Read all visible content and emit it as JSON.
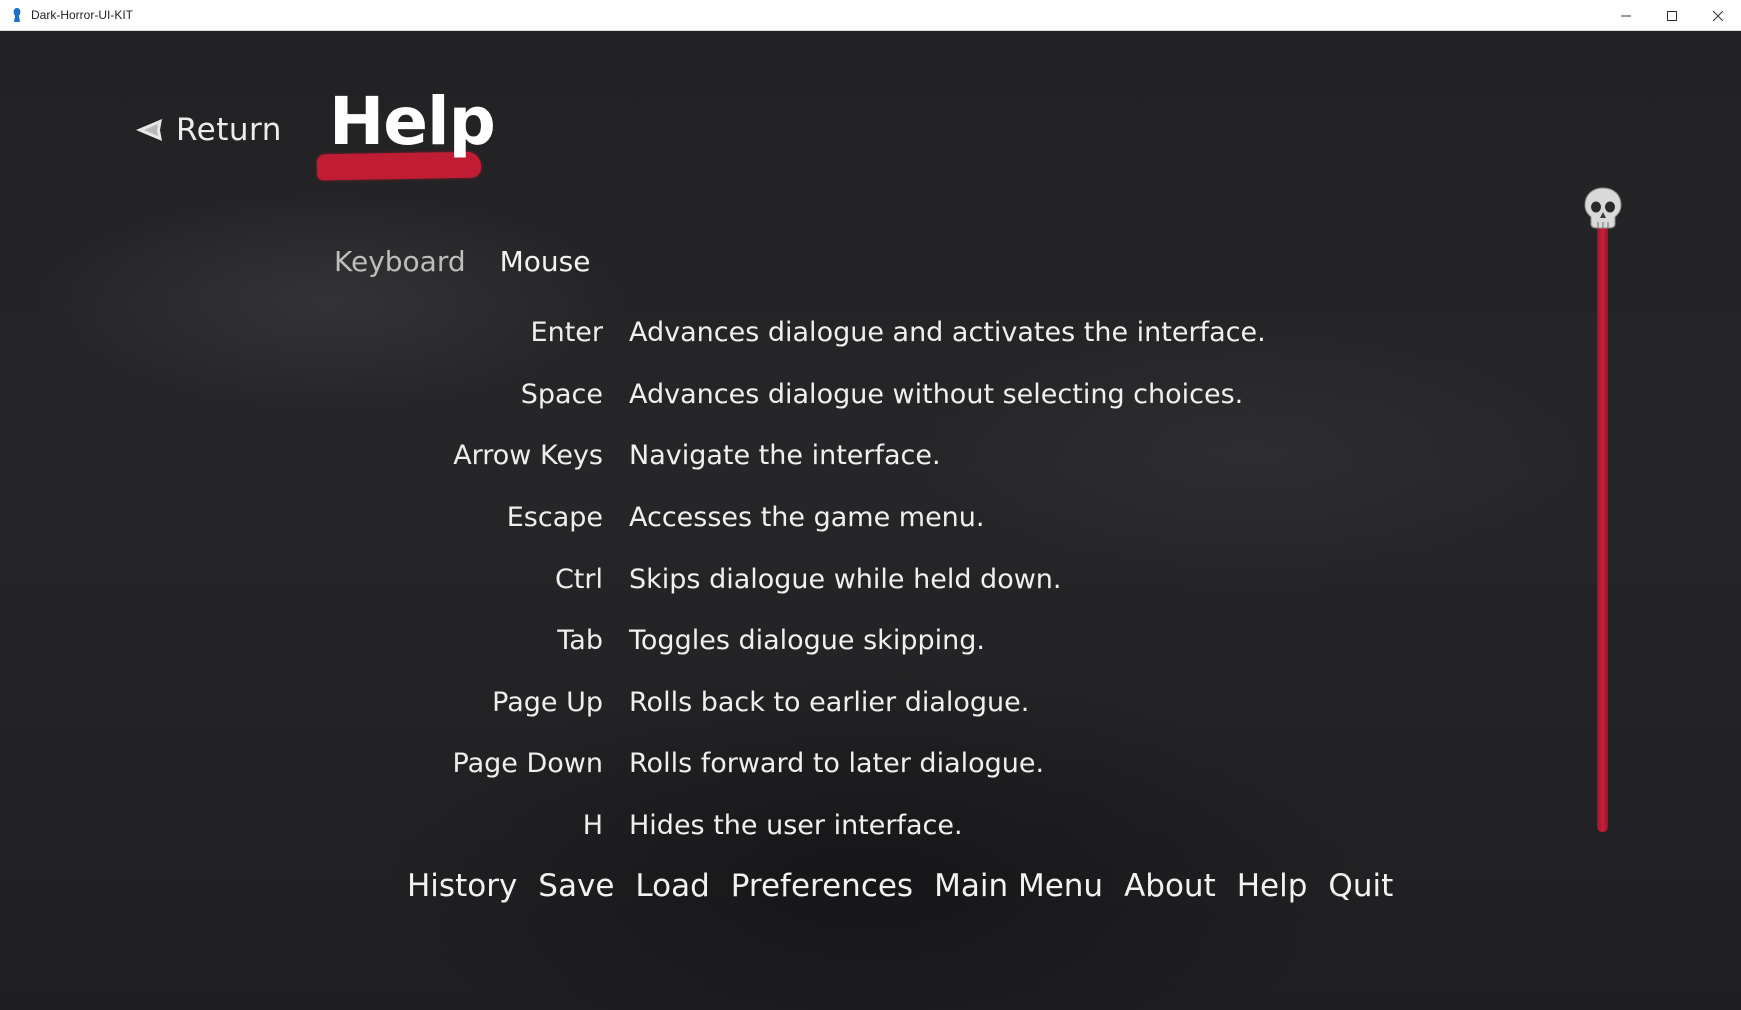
{
  "window": {
    "title": "Dark-Horror-UI-KIT",
    "controls": {
      "minimize": "—",
      "maximize": "☐",
      "close": "✕"
    }
  },
  "header": {
    "return_label": "Return",
    "page_title": "Help"
  },
  "tabs": [
    {
      "label": "Keyboard",
      "active": false
    },
    {
      "label": "Mouse",
      "active": true
    }
  ],
  "help_rows": [
    {
      "key": "Enter",
      "desc": "Advances dialogue and activates the interface."
    },
    {
      "key": "Space",
      "desc": "Advances dialogue without selecting choices."
    },
    {
      "key": "Arrow Keys",
      "desc": "Navigate the interface."
    },
    {
      "key": "Escape",
      "desc": "Accesses the game menu."
    },
    {
      "key": "Ctrl",
      "desc": "Skips dialogue while held down."
    },
    {
      "key": "Tab",
      "desc": "Toggles dialogue skipping."
    },
    {
      "key": "Page Up",
      "desc": "Rolls back to earlier dialogue."
    },
    {
      "key": "Page Down",
      "desc": "Rolls forward to later dialogue."
    },
    {
      "key": "H",
      "desc": "Hides the user interface."
    }
  ],
  "nav": [
    {
      "label": "History"
    },
    {
      "label": "Save"
    },
    {
      "label": "Load"
    },
    {
      "label": "Preferences"
    },
    {
      "label": "Main Menu"
    },
    {
      "label": "About"
    },
    {
      "label": "Help"
    },
    {
      "label": "Quit"
    }
  ],
  "scrollbar": {
    "position_fraction": 0.0,
    "thumb_icon": "skull-icon"
  },
  "colors": {
    "accent": "#c01d34",
    "background": "#232325",
    "text": "#f0f0f0"
  }
}
